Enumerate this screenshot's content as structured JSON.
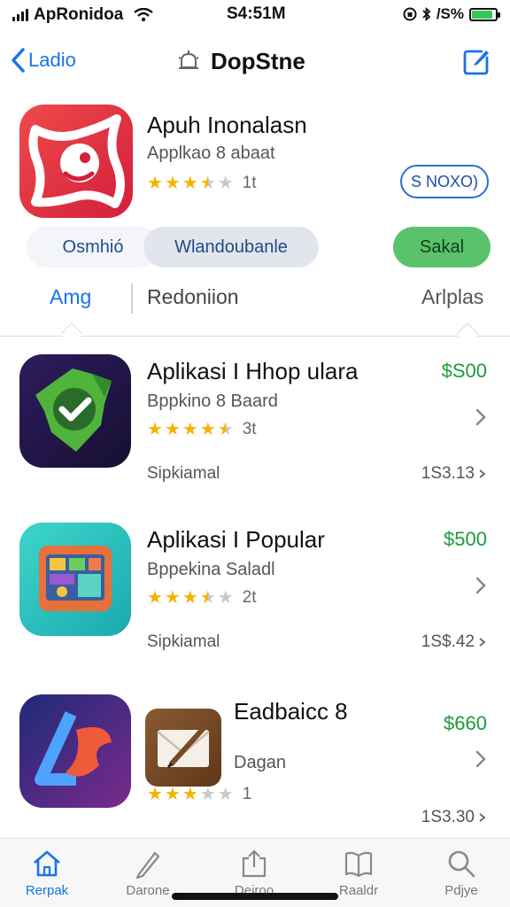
{
  "status": {
    "carrier": "ApRonidoa",
    "time": "S4:51M",
    "battery_text": "/S%",
    "battery_level": 0.9
  },
  "nav": {
    "back_label": "Ladio",
    "title": "DopStne"
  },
  "featured": {
    "title": "Apuh Inonalasn",
    "subtitle": "Applkao 8 abaat",
    "rating": 3.5,
    "rating_count": "1t",
    "price": "S NOXO)",
    "segment_1": "Osmhió",
    "segment_2": "Wlandoubanle",
    "segment_3": "Sakal"
  },
  "tabs": [
    "Amg",
    "Redoniion",
    "Arlplas"
  ],
  "rows": [
    {
      "title": "Aplikasi I Hhop ulara",
      "subtitle": "Bppkino 8 Baard",
      "rating": 4.5,
      "rating_count": "3t",
      "price": "$S00",
      "meta_left": "Sipkiamal",
      "meta_right": "1S3.13"
    },
    {
      "title": "Aplikasi I Popular",
      "subtitle": "Bppekina Saladl",
      "rating": 3.5,
      "rating_count": "2t",
      "price": "$500",
      "meta_left": "Sipkiamal",
      "meta_right": "1S$.42"
    },
    {
      "title": "Eadbaicc 8",
      "subtitle": "Dagan",
      "rating": 3,
      "rating_count": "1",
      "price": "$660",
      "meta_left": "",
      "meta_right": "1S3.30"
    }
  ],
  "tabbar": [
    "Rerpak",
    "Darone",
    "Deiroo",
    "Raaldr",
    "Pdjye"
  ],
  "colors": {
    "accent": "#1a73e8",
    "price_green": "#1a9c3a",
    "get_button": "#5ac26a",
    "star": "#f5b300"
  }
}
